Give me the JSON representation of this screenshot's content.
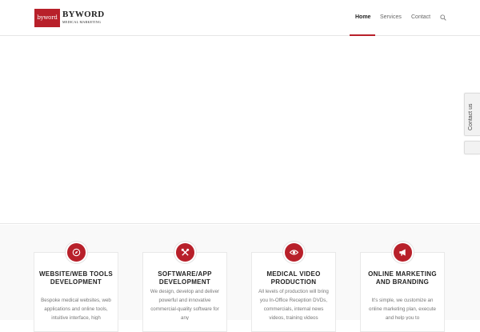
{
  "brand": {
    "mark": "byword",
    "name": "BYWORD",
    "tagline": "MEDICAL MARKETING",
    "accent": "#b8202a"
  },
  "nav": {
    "items": [
      {
        "label": "Home",
        "active": true
      },
      {
        "label": "Services",
        "active": false
      },
      {
        "label": "Contact",
        "active": false
      }
    ],
    "search_icon": "search-icon"
  },
  "side_tab": {
    "label": "Contact us"
  },
  "services": [
    {
      "icon": "compass-icon",
      "title": "Website/Web Tools Development",
      "text": "Bespoke medical websites, web applications and online tools, intuitive interface, high"
    },
    {
      "icon": "tools-icon",
      "title": "Software/App Development",
      "text": "We design, develop and deliver powerful and innovative commercial-quality software for any"
    },
    {
      "icon": "eye-icon",
      "title": "Medical Video Production",
      "text": "All levels of production will bring you In-Office Reception DVDs, commercials, internal news videos, training videos"
    },
    {
      "icon": "megaphone-icon",
      "title": "Online Marketing and Branding",
      "text": "It's simple, we customize an online marketing plan, execute and help you to"
    }
  ]
}
